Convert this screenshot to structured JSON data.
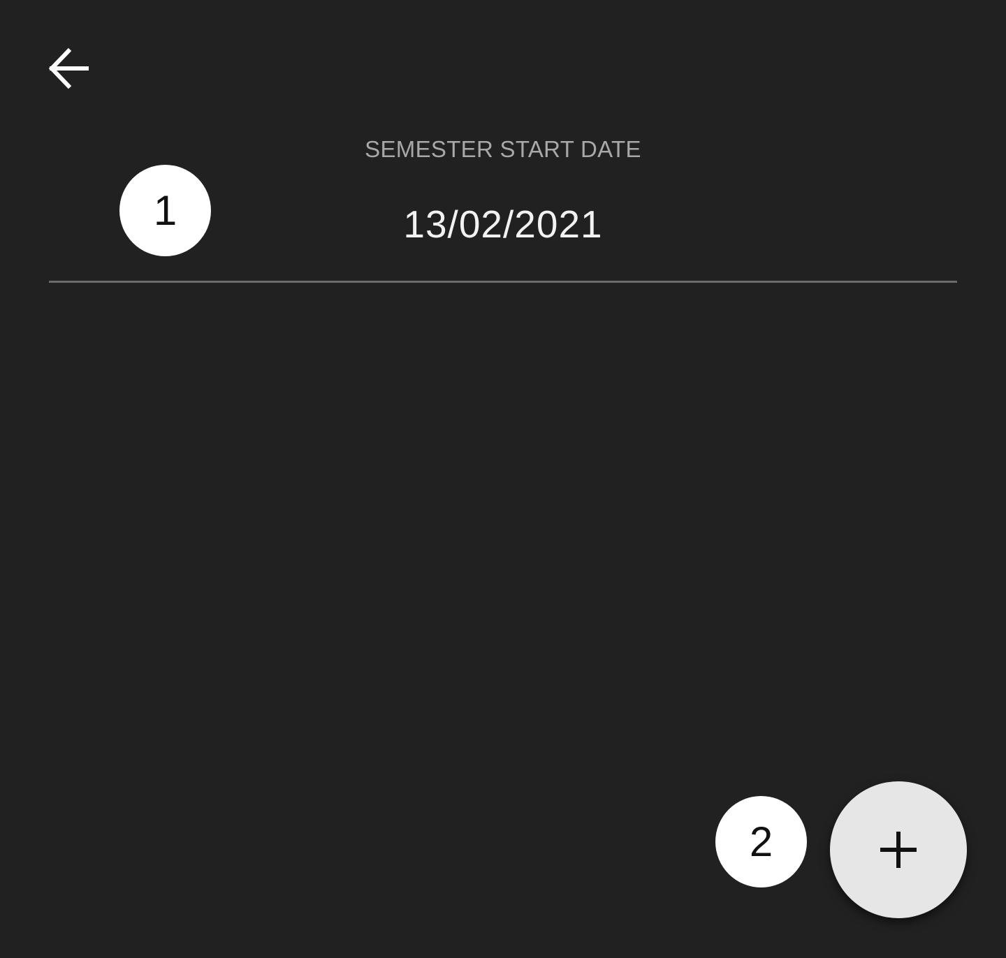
{
  "header": {
    "back_icon": "arrow-left-icon"
  },
  "semester": {
    "label": "SEMESTER START DATE",
    "start_date": "13/02/2021"
  },
  "markers": {
    "first": "1",
    "second": "2"
  },
  "fab": {
    "icon": "plus-icon"
  },
  "colors": {
    "background": "#212121",
    "label_text": "#a8a8a8",
    "value_text": "#f2f2f2",
    "divider": "#6b6b6b",
    "fab_background": "#e6e6e6",
    "marker_background": "#ffffff"
  }
}
